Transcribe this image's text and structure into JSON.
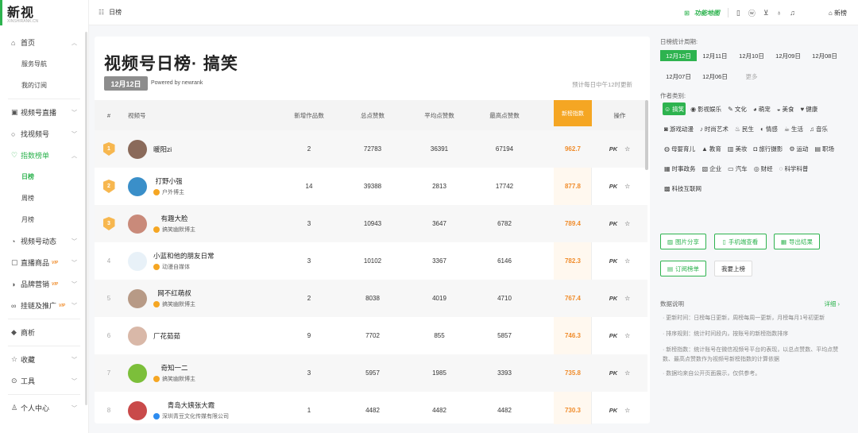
{
  "brand": {
    "name": "新视",
    "subtitle": "XINSHIRANK.CN"
  },
  "sidebar": {
    "items": [
      {
        "label": "首页",
        "icon": "home-icon",
        "glyph": "⌂",
        "chevron": "up"
      },
      {
        "label": "服务导航",
        "sub": true
      },
      {
        "label": "我的订阅",
        "sub": true
      },
      {
        "label": "视频号直播",
        "icon": "live-icon",
        "glyph": "▣",
        "chevron": "down"
      },
      {
        "label": "找视频号",
        "icon": "search-icon",
        "glyph": "○",
        "chevron": "down"
      },
      {
        "label": "指数榜单",
        "icon": "rank-icon",
        "glyph": "♡",
        "chevron": "up",
        "active": true
      },
      {
        "label": "日榜",
        "sub": true,
        "active": true
      },
      {
        "label": "周榜",
        "sub": true
      },
      {
        "label": "月榜",
        "sub": true
      },
      {
        "label": "视频号动态",
        "icon": "activity-icon",
        "glyph": "◔",
        "chevron": "down"
      },
      {
        "label": "直播商品",
        "icon": "goods-icon",
        "glyph": "▢",
        "chevron": "down",
        "tag": "VIP"
      },
      {
        "label": "品牌营销",
        "icon": "brand-icon",
        "glyph": "◑",
        "chevron": "down",
        "tag": "VIP"
      },
      {
        "label": "挂链及推广",
        "icon": "link-icon",
        "glyph": "∞",
        "chevron": "down",
        "tag": "VIP"
      },
      {
        "label": "商析",
        "icon": "analysis-icon",
        "glyph": "◆"
      },
      {
        "label": "收藏",
        "icon": "star-icon",
        "glyph": "☆",
        "chevron": "down"
      },
      {
        "label": "工具",
        "icon": "tool-icon",
        "glyph": "⊙",
        "chevron": "down"
      },
      {
        "label": "个人中心",
        "icon": "user-icon",
        "glyph": "♙",
        "chevron": "down"
      }
    ]
  },
  "topbar": {
    "breadcrumb": "日榜",
    "map_label": "功能地图",
    "home_label": "新榜"
  },
  "main": {
    "title": "视频号日榜· 搞笑",
    "date_badge": "12月12日",
    "powered": "Powered by newrank",
    "update_note": "预计每日中午12时更新",
    "headers": {
      "rank": "#",
      "account": "视频号",
      "works": "新增作品数",
      "total": "总点赞数",
      "avg": "平均点赞数",
      "max": "最高点赞数",
      "index": "新榜指数",
      "ops": "操作"
    },
    "pk_label": "PK",
    "rows": [
      {
        "rank": "1",
        "name": "暖阳zi",
        "role": "",
        "works": "2",
        "total": "72783",
        "avg": "36391",
        "max": "67194",
        "index": "962.7",
        "avatar_color": "#8a6a5a"
      },
      {
        "rank": "2",
        "name": "打野小强",
        "role": "户外博主",
        "works": "14",
        "total": "39388",
        "avg": "2813",
        "max": "17742",
        "index": "877.8",
        "avatar_color": "#3a8fc9"
      },
      {
        "rank": "3",
        "name": "有趣大脸",
        "role": "搞笑幽默博主",
        "works": "3",
        "total": "10943",
        "avg": "3647",
        "max": "6782",
        "index": "789.4",
        "avatar_color": "#c98a7a"
      },
      {
        "rank": "4",
        "name": "小蓝和他的朋友日常",
        "role": "动漫自媒体",
        "works": "3",
        "total": "10102",
        "avg": "3367",
        "max": "6146",
        "index": "782.3",
        "avatar_color": "#e8f1f8"
      },
      {
        "rank": "5",
        "name": "网不红萌叔",
        "role": "搞笑幽默博主",
        "works": "2",
        "total": "8038",
        "avg": "4019",
        "max": "4710",
        "index": "767.4",
        "avatar_color": "#b79a86"
      },
      {
        "rank": "6",
        "name": "厂花茹茹",
        "role": "",
        "works": "9",
        "total": "7702",
        "avg": "855",
        "max": "5857",
        "index": "746.3",
        "avatar_color": "#d9b8a8"
      },
      {
        "rank": "7",
        "name": "奇知一二",
        "role": "搞笑幽默博主",
        "works": "3",
        "total": "5957",
        "avg": "1985",
        "max": "3393",
        "index": "735.8",
        "avatar_color": "#7cbf3a"
      },
      {
        "rank": "8",
        "name": "青岛大姨张大霞",
        "role": "深圳青豆文化传媒有限公司",
        "works": "1",
        "total": "4482",
        "avg": "4482",
        "max": "4482",
        "index": "730.3",
        "avatar_color": "#c94a4a",
        "role_blue": true
      }
    ]
  },
  "rpanel": {
    "period_label": "日榜统计周期:",
    "dates": [
      "12月12日",
      "12月11日",
      "12月10日",
      "12月09日",
      "12月08日",
      "12月07日",
      "12月06日",
      "更多"
    ],
    "category_label": "作者类别:",
    "categories": [
      {
        "label": "搞笑",
        "icon": "☺",
        "active": true
      },
      {
        "label": "影视娱乐",
        "icon": "◉"
      },
      {
        "label": "文化",
        "icon": "✎"
      },
      {
        "label": "萌宠",
        "icon": "◕"
      },
      {
        "label": "美食",
        "icon": "◒"
      },
      {
        "label": "健康",
        "icon": "♥"
      },
      {
        "label": "游戏动漫",
        "icon": "◙"
      },
      {
        "label": "时尚艺术",
        "icon": "♪"
      },
      {
        "label": "民生",
        "icon": "♨"
      },
      {
        "label": "情感",
        "icon": "◐"
      },
      {
        "label": "生活",
        "icon": "☕"
      },
      {
        "label": "音乐",
        "icon": "♫"
      },
      {
        "label": "母婴育儿",
        "icon": "◍"
      },
      {
        "label": "教育",
        "icon": "▲"
      },
      {
        "label": "美妆",
        "icon": "▥"
      },
      {
        "label": "旅行摄影",
        "icon": "◘"
      },
      {
        "label": "运动",
        "icon": "⚙"
      },
      {
        "label": "职场",
        "icon": "▤"
      },
      {
        "label": "时事政务",
        "icon": "▦"
      },
      {
        "label": "企业",
        "icon": "▧"
      },
      {
        "label": "汽车",
        "icon": "▭"
      },
      {
        "label": "财经",
        "icon": "◎"
      },
      {
        "label": "科学科普",
        "icon": "◌"
      },
      {
        "label": "科技互联网",
        "icon": "▩"
      }
    ],
    "actions": {
      "share": "图片分享",
      "phone": "手机端查看",
      "export": "导出结果",
      "subscribe": "订阅榜单",
      "submit": "我要上榜"
    },
    "notes_title": "数据说明",
    "notes_more": "详细 ›",
    "notes": [
      "· 更新时间：日榜每日更新，周榜每周一更新，月榜每月1号初更新",
      "· 排序规则：统计时间段内，按账号的新榜指数排序",
      "· 新榜指数：统计账号在微信视频号平台的表现，以总点赞数、平均点赞数、最高点赞数作为视频号新榜指数的计算依据",
      "· 数据均来自公开页面展示，仅供参考。"
    ]
  }
}
